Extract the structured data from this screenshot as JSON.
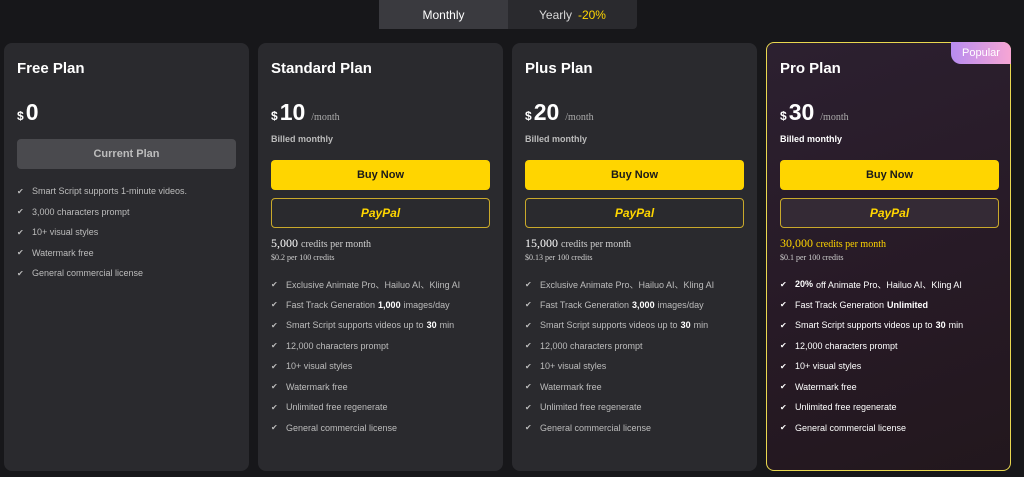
{
  "toggle": {
    "monthly_label": "Monthly",
    "yearly_label": "Yearly",
    "yearly_discount": "-20%"
  },
  "plans": [
    {
      "title": "Free Plan",
      "currency": "$",
      "price": "0",
      "button_label": "Current Plan",
      "features": [
        "Smart Script supports 1-minute videos.",
        "3,000 characters prompt",
        "10+ visual styles",
        "Watermark free",
        "General commercial license"
      ]
    },
    {
      "title": "Standard Plan",
      "currency": "$",
      "price": "10",
      "period": "/month",
      "billed": "Billed monthly",
      "buy_label": "Buy Now",
      "paypal_label": "PayPal",
      "credits_amount": "5,000",
      "credits_label": "credits per month",
      "credits_rate": "$0.2 per 100 credits",
      "features": [
        {
          "pre": "Exclusive Animate Pro、Hailuo AI、Kling AI",
          "bold": "",
          "post": ""
        },
        {
          "pre": "Fast Track Generation",
          "bold": "1,000",
          "post": "images/day"
        },
        {
          "pre": "Smart Script supports videos up to",
          "bold": "30",
          "post": "min"
        },
        {
          "pre": "12,000 characters prompt",
          "bold": "",
          "post": ""
        },
        {
          "pre": "10+ visual styles",
          "bold": "",
          "post": ""
        },
        {
          "pre": "Watermark free",
          "bold": "",
          "post": ""
        },
        {
          "pre": "Unlimited free regenerate",
          "bold": "",
          "post": ""
        },
        {
          "pre": "General commercial license",
          "bold": "",
          "post": ""
        }
      ]
    },
    {
      "title": "Plus Plan",
      "currency": "$",
      "price": "20",
      "period": "/month",
      "billed": "Billed monthly",
      "buy_label": "Buy Now",
      "paypal_label": "PayPal",
      "credits_amount": "15,000",
      "credits_label": "credits per month",
      "credits_rate": "$0.13 per 100 credits",
      "features": [
        {
          "pre": "Exclusive Animate Pro、Hailuo AI、Kling AI",
          "bold": "",
          "post": ""
        },
        {
          "pre": "Fast Track Generation",
          "bold": "3,000",
          "post": "images/day"
        },
        {
          "pre": "Smart Script supports videos up to",
          "bold": "30",
          "post": "min"
        },
        {
          "pre": "12,000 characters prompt",
          "bold": "",
          "post": ""
        },
        {
          "pre": "10+ visual styles",
          "bold": "",
          "post": ""
        },
        {
          "pre": "Watermark free",
          "bold": "",
          "post": ""
        },
        {
          "pre": "Unlimited free regenerate",
          "bold": "",
          "post": ""
        },
        {
          "pre": "General commercial license",
          "bold": "",
          "post": ""
        }
      ]
    },
    {
      "title": "Pro Plan",
      "badge": "Popular",
      "currency": "$",
      "price": "30",
      "period": "/month",
      "billed": "Billed monthly",
      "buy_label": "Buy Now",
      "paypal_label": "PayPal",
      "credits_amount": "30,000",
      "credits_label": "credits per month",
      "credits_rate": "$0.1 per 100 credits",
      "features": [
        {
          "pre": "",
          "bold": "20%",
          "post": "off Animate Pro、Hailuo AI、Kling AI"
        },
        {
          "pre": "Fast Track Generation",
          "bold": "Unlimited",
          "post": ""
        },
        {
          "pre": "Smart Script supports videos up to",
          "bold": "30",
          "post": "min"
        },
        {
          "pre": "12,000 characters prompt",
          "bold": "",
          "post": ""
        },
        {
          "pre": "10+ visual styles",
          "bold": "",
          "post": ""
        },
        {
          "pre": "Watermark free",
          "bold": "",
          "post": ""
        },
        {
          "pre": "Unlimited free regenerate",
          "bold": "",
          "post": ""
        },
        {
          "pre": "General commercial license",
          "bold": "",
          "post": ""
        }
      ]
    }
  ],
  "icons": {
    "check": "check-icon"
  },
  "colors": {
    "accent_yellow": "#ffd500",
    "background": "#17171a",
    "card": "#2a2a2e",
    "badge_gradient_start": "#b78cf0",
    "badge_gradient_end": "#f7a6d4"
  }
}
